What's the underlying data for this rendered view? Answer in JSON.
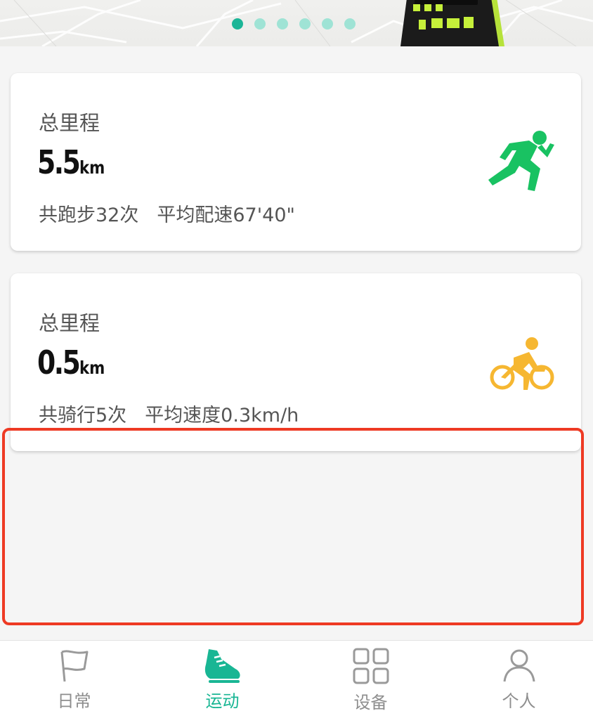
{
  "banner": {
    "dot_count": 6,
    "active_dot": 0,
    "colors": {
      "active_dot": "#1bb597",
      "inactive_dot": "#9fe3d5"
    }
  },
  "cards": [
    {
      "label": "总里程",
      "value": "5.5",
      "unit": "km",
      "stat_count": "共跑步32次",
      "stat_avg": "平均配速67'40\"",
      "icon": "running-man-icon",
      "icon_color": "#19c262"
    },
    {
      "label": "总里程",
      "value": "0.5",
      "unit": "km",
      "stat_count": "共骑行5次",
      "stat_avg": "平均速度0.3km/h",
      "icon": "cyclist-icon",
      "icon_color": "#f6b731"
    }
  ],
  "highlight": {
    "color": "#ee3a24"
  },
  "tabbar": {
    "active": 1,
    "active_color": "#19b694",
    "inactive_color": "#8e8e8e",
    "items": [
      {
        "label": "日常",
        "icon": "flag-icon"
      },
      {
        "label": "运动",
        "icon": "sneaker-icon"
      },
      {
        "label": "设备",
        "icon": "grid-icon"
      },
      {
        "label": "个人",
        "icon": "person-icon"
      }
    ]
  }
}
